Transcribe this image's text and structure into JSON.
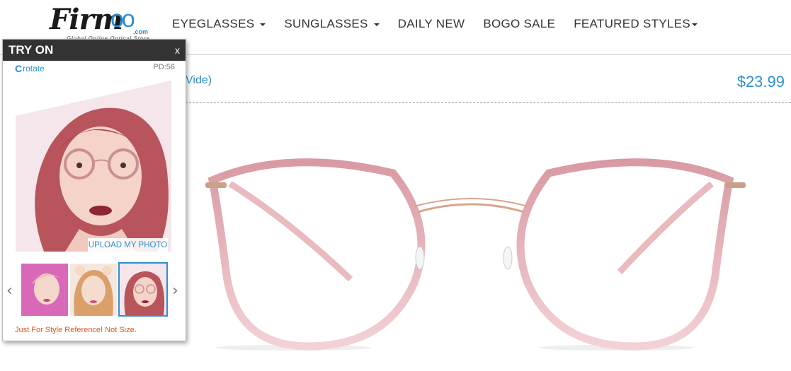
{
  "logo": {
    "brand": "Firm",
    "oo": "oo",
    "domain": ".com",
    "tagline": "Global Online Optical Store"
  },
  "nav": [
    {
      "label": "EYEGLASSES",
      "dropdown": true
    },
    {
      "label": "SUNGLASSES",
      "dropdown": true
    },
    {
      "label": "DAILY NEW",
      "dropdown": false
    },
    {
      "label": "BOGO SALE",
      "dropdown": false
    },
    {
      "label": "FEATURED STYLES",
      "dropdown": true
    }
  ],
  "product": {
    "title_fragment": "Vide)",
    "price": "$23.99"
  },
  "tryon": {
    "title": "TRY ON",
    "close": "x",
    "rotate_label": "rotate",
    "pd": "PD:56",
    "upload_label": "UPLOAD MY PHOTO",
    "note": "Just For Style Reference! Not Size.",
    "selected_thumb": 3
  },
  "colors": {
    "accent": "#2d8fd0",
    "note": "#e0561c",
    "frame": "#e8b4b8"
  }
}
